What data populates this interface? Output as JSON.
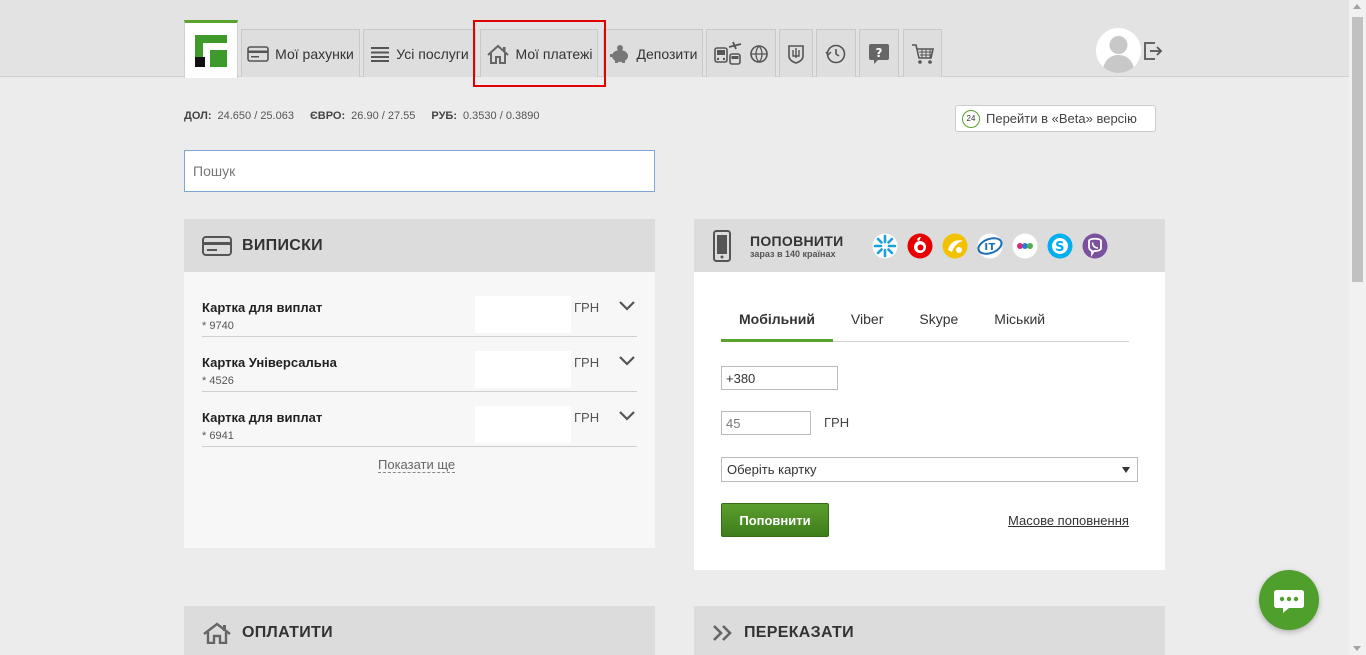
{
  "nav": {
    "tabs": [
      {
        "label": "Мої рахунки",
        "icon": "card-icon"
      },
      {
        "label": "Усі послуги",
        "icon": "list-icon"
      },
      {
        "label": "Мої платежі",
        "icon": "house-icon"
      },
      {
        "label": "Депозити",
        "icon": "piggy-bank-icon"
      }
    ],
    "icon_tabs": [
      "transport-icon",
      "globe-icon",
      "coat-of-arms-icon",
      "clock-icon",
      "help-icon",
      "cart-icon"
    ]
  },
  "rates": [
    {
      "label": "ДОЛ:",
      "value": "24.650 / 25.063"
    },
    {
      "label": "ЄВРО:",
      "value": "26.90 / 27.55"
    },
    {
      "label": "РУБ:",
      "value": "0.3530 / 0.3890"
    }
  ],
  "beta": {
    "badge": "24",
    "label": "Перейти в «Beta» версію"
  },
  "search": {
    "placeholder": "Пошук"
  },
  "statements": {
    "title": "ВИПИСКИ",
    "items": [
      {
        "name": "Картка для виплат",
        "number": "* 9740",
        "currency": "ГРН"
      },
      {
        "name": "Картка Універсальна",
        "number": "* 4526",
        "currency": "ГРН"
      },
      {
        "name": "Картка для виплат",
        "number": "* 6941",
        "currency": "ГРН"
      }
    ],
    "show_more": "Показати ще"
  },
  "topup": {
    "title": "ПОПОВНИТИ",
    "subtitle": "зараз в 140 країнах",
    "operators": [
      {
        "name": "kyivstar-icon",
        "color": "#1aa0dc"
      },
      {
        "name": "vodafone-icon",
        "color": "#e60000"
      },
      {
        "name": "lifecell-icon",
        "color": "#f2c200"
      },
      {
        "name": "intertelecom-icon",
        "color": "#1a6fb8"
      },
      {
        "name": "trimob-icon",
        "color": "#ffffff"
      },
      {
        "name": "skype-icon",
        "color": "#00aff0"
      },
      {
        "name": "viber-icon",
        "color": "#7b519d"
      }
    ],
    "tabs": [
      "Мобільний",
      "Viber",
      "Skype",
      "Міський"
    ],
    "phone_value": "+380",
    "amount_value": "45",
    "amount_currency": "ГРН",
    "card_select": "Оберіть картку",
    "submit": "Поповнити",
    "mass_link": "Масове поповнення"
  },
  "pay": {
    "title": "ОПЛАТИТИ"
  },
  "transfer": {
    "title": "ПЕРЕКАЗАТИ"
  }
}
